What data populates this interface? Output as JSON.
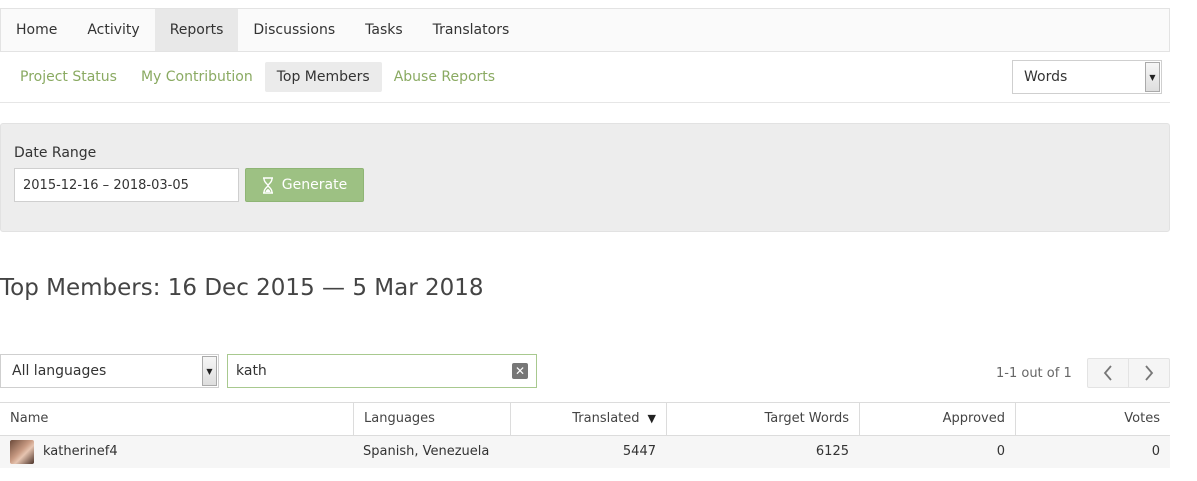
{
  "topnav": {
    "tabs": [
      {
        "label": "Home",
        "active": false
      },
      {
        "label": "Activity",
        "active": false
      },
      {
        "label": "Reports",
        "active": true
      },
      {
        "label": "Discussions",
        "active": false
      },
      {
        "label": "Tasks",
        "active": false
      },
      {
        "label": "Translators",
        "active": false
      }
    ]
  },
  "subnav": {
    "items": [
      {
        "label": "Project Status",
        "active": false
      },
      {
        "label": "My Contribution",
        "active": false
      },
      {
        "label": "Top Members",
        "active": true
      },
      {
        "label": "Abuse Reports",
        "active": false
      }
    ],
    "metric_select": "Words"
  },
  "date_panel": {
    "label": "Date Range",
    "value": "2015-12-16 – 2018-03-05",
    "generate_label": "Generate"
  },
  "page_title": "Top Members: 16 Dec 2015 — 5 Mar 2018",
  "filters": {
    "language_select": "All languages",
    "search_value": "kath"
  },
  "pager": {
    "text": "1-1 out of 1"
  },
  "table": {
    "headers": {
      "name": "Name",
      "languages": "Languages",
      "translated": "Translated",
      "target_words": "Target Words",
      "approved": "Approved",
      "votes": "Votes"
    },
    "rows": [
      {
        "name": "katherinef4",
        "languages": "Spanish, Venezuela",
        "translated": "5447",
        "target_words": "6125",
        "approved": "0",
        "votes": "0"
      }
    ]
  },
  "colors": {
    "accent_green": "#8aaa62",
    "button_green": "#9dc183",
    "panel_bg": "#ededed"
  }
}
